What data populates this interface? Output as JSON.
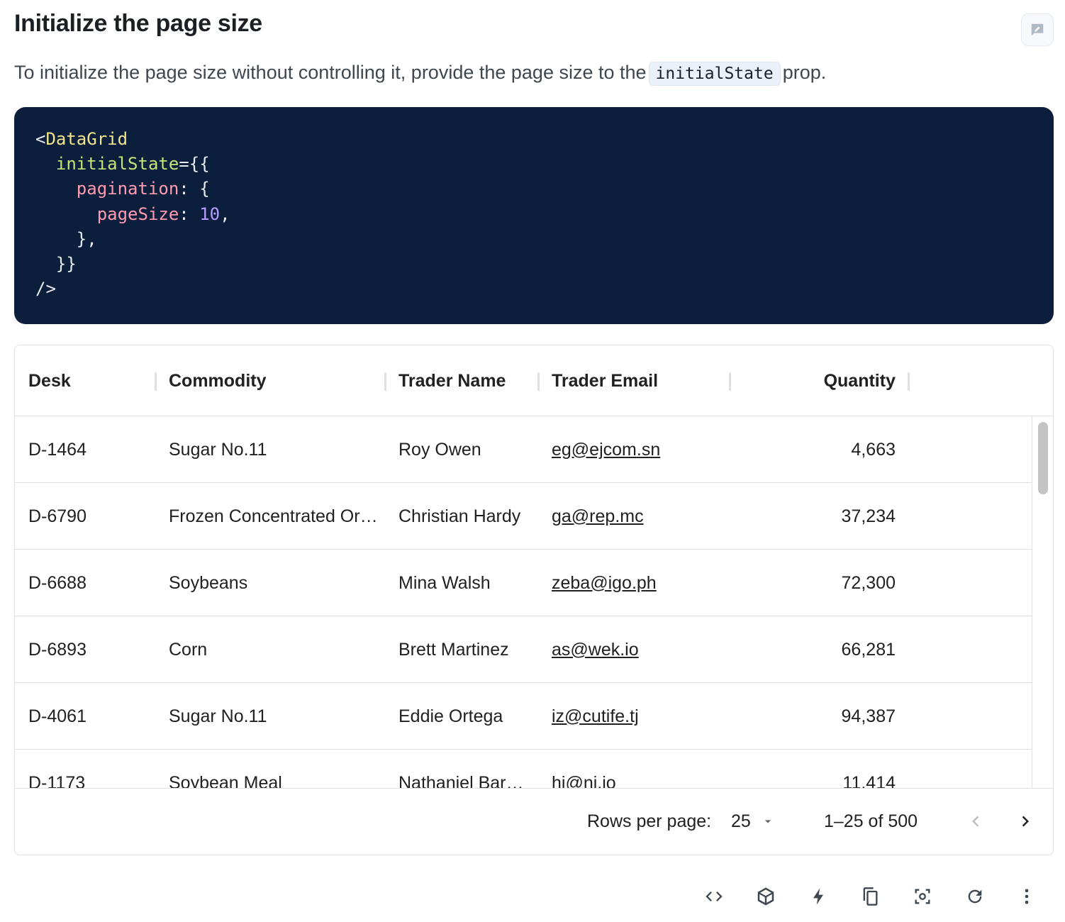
{
  "section": {
    "title": "Initialize the page size",
    "description_before": "To initialize the page size without controlling it, provide the page size to the",
    "description_code": "initialState",
    "description_after": "prop."
  },
  "code": {
    "line1_tag": "DataGrid",
    "line2_attr": "initialState",
    "line3_key": "pagination",
    "line4_key": "pageSize",
    "line4_value": "10"
  },
  "grid": {
    "columns": [
      "Desk",
      "Commodity",
      "Trader Name",
      "Trader Email",
      "Quantity"
    ],
    "rows": [
      {
        "desk": "D-1464",
        "commodity": "Sugar No.11",
        "trader": "Roy Owen",
        "email": "eg@ejcom.sn",
        "quantity": "4,663"
      },
      {
        "desk": "D-6790",
        "commodity": "Frozen Concentrated Or…",
        "trader": "Christian Hardy",
        "email": "ga@rep.mc",
        "quantity": "37,234"
      },
      {
        "desk": "D-6688",
        "commodity": "Soybeans",
        "trader": "Mina Walsh",
        "email": "zeba@igo.ph",
        "quantity": "72,300"
      },
      {
        "desk": "D-6893",
        "commodity": "Corn",
        "trader": "Brett Martinez",
        "email": "as@wek.io",
        "quantity": "66,281"
      },
      {
        "desk": "D-4061",
        "commodity": "Sugar No.11",
        "trader": "Eddie Ortega",
        "email": "iz@cutife.tj",
        "quantity": "94,387"
      },
      {
        "desk": "D-1173",
        "commodity": "Soybean Meal",
        "trader": "Nathaniel Bar…",
        "email": "hi@ni.io",
        "quantity": "11,414"
      }
    ],
    "footer": {
      "rows_per_page_label": "Rows per page:",
      "rows_per_page_value": "25",
      "range": "1–25 of 500"
    }
  },
  "toolbar": {
    "buttons": [
      "code-icon",
      "codesandbox-icon",
      "stackblitz-icon",
      "copy-icon",
      "screenshot-icon",
      "reset-icon",
      "more-icon"
    ]
  }
}
